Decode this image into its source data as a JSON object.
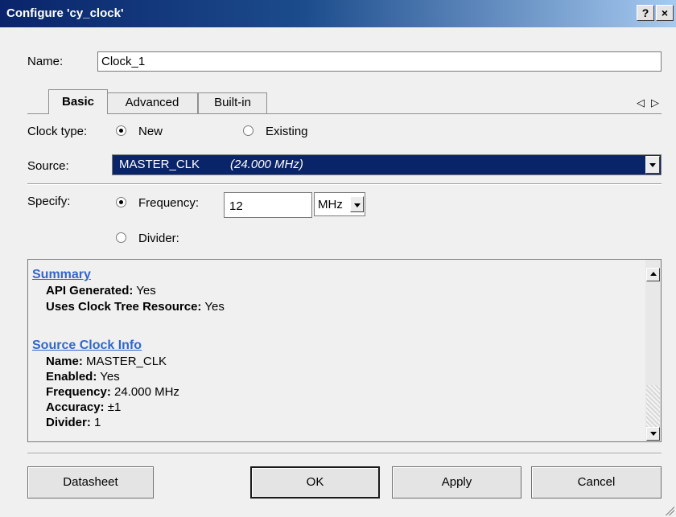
{
  "window": {
    "title": "Configure 'cy_clock'",
    "help_label": "?",
    "close_label": "×"
  },
  "name_field": {
    "label": "Name:",
    "value": "Clock_1"
  },
  "tabs": [
    {
      "label": "Basic",
      "active": true
    },
    {
      "label": "Advanced",
      "active": false
    },
    {
      "label": "Built-in",
      "active": false
    }
  ],
  "tab_scroll": {
    "left": "◁",
    "right": "▷"
  },
  "clock_type": {
    "label": "Clock type:",
    "options": [
      {
        "label": "New",
        "checked": true
      },
      {
        "label": "Existing",
        "checked": false
      }
    ]
  },
  "source": {
    "label": "Source:",
    "value_name": "MASTER_CLK",
    "value_freq": "(24.000 MHz)"
  },
  "specify": {
    "label": "Specify:",
    "frequency_label": "Frequency:",
    "frequency_value": "12",
    "unit": "MHz",
    "divider_label": "Divider:",
    "frequency_checked": true
  },
  "summary": {
    "sections": [
      {
        "heading": "Summary",
        "rows": [
          {
            "key": "API Generated:",
            "value": "Yes"
          },
          {
            "key": "Uses Clock Tree Resource:",
            "value": "Yes"
          }
        ]
      },
      {
        "heading": "Source Clock Info",
        "rows": [
          {
            "key": "Name:",
            "value": "MASTER_CLK"
          },
          {
            "key": "Enabled:",
            "value": "Yes"
          },
          {
            "key": "Frequency:",
            "value": "24.000 MHz"
          },
          {
            "key": "Accuracy:",
            "value": "±1"
          },
          {
            "key": "Divider:",
            "value": "1"
          }
        ]
      }
    ]
  },
  "buttons": {
    "datasheet": "Datasheet",
    "ok": "OK",
    "apply": "Apply",
    "cancel": "Cancel"
  },
  "colors": {
    "title_bar": "#0a246a",
    "selection": "#0a246a",
    "link": "#3366cc"
  }
}
